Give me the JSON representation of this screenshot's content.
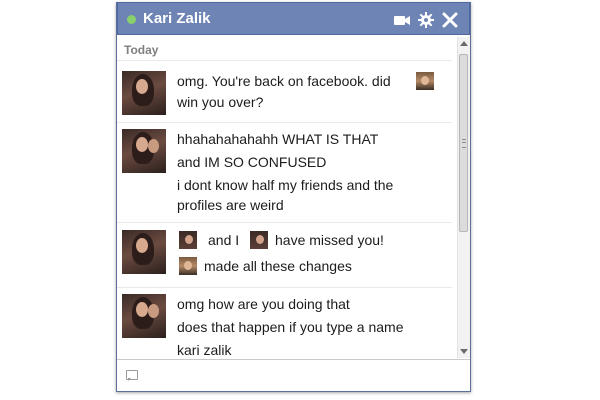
{
  "chat": {
    "contact_name": "Kari Zalik",
    "status_color": "#8ad06e",
    "titlebar_color": "#6d84b4",
    "icons": [
      "video-camera-icon",
      "gear-icon",
      "close-icon"
    ],
    "date_separator": "Today"
  },
  "messages": {
    "m1": {
      "line1": "omg. You're back on facebook. did",
      "line2": "win you over?"
    },
    "m2": {
      "line1": "hhahahahahahh WHAT IS THAT",
      "line2": "and IM SO CONFUSED",
      "line3": "i dont know half my friends and the",
      "line4": "profiles are weird"
    },
    "m3": {
      "line1a": "and I",
      "line1b": "have missed you!",
      "line2": "made all these changes"
    },
    "m4": {
      "line1": "omg how are you doing that",
      "line2": "does that happen if you type a name",
      "line3": "kari zalik"
    }
  }
}
